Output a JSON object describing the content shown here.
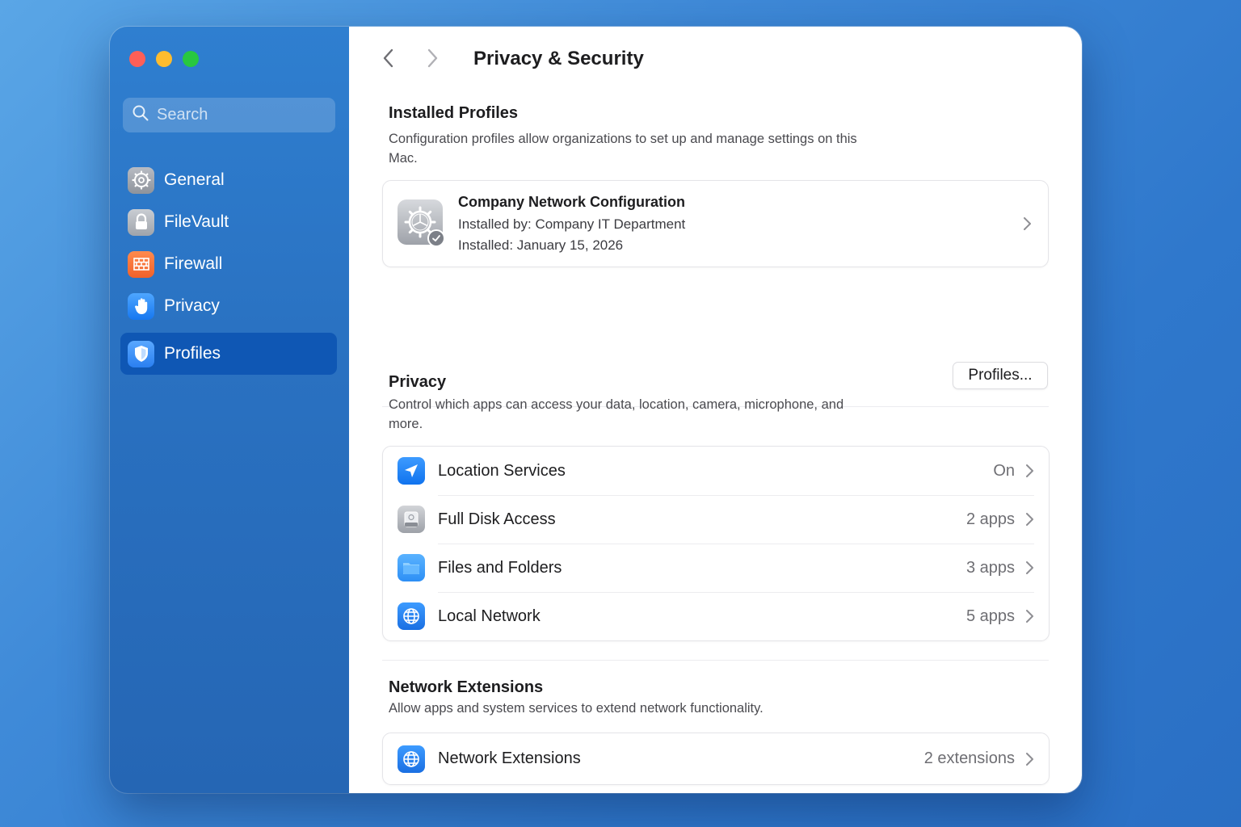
{
  "window": {
    "title": "Privacy & Security"
  },
  "sidebar": {
    "search_placeholder": "Search",
    "items": [
      {
        "label": "General",
        "icon": "gear-icon"
      },
      {
        "label": "FileVault",
        "icon": "lock-icon"
      },
      {
        "label": "Firewall",
        "icon": "firewall-icon"
      },
      {
        "label": "Privacy",
        "icon": "hand-icon"
      },
      {
        "label": "Profiles",
        "icon": "shield-icon",
        "selected": true
      }
    ]
  },
  "main": {
    "installed_profiles": {
      "title": "Installed Profiles",
      "description": "Configuration profiles allow organizations to set up and manage settings on this Mac.",
      "profile": {
        "name": "Company Network Configuration",
        "installed_by": "Installed by: Company IT Department",
        "installed_date": "Installed: January 15, 2026"
      },
      "profiles_button": "Profiles..."
    },
    "privacy": {
      "title": "Privacy",
      "description": "Control which apps can access your data, location, camera, microphone, and more.",
      "rows": [
        {
          "label": "Location Services",
          "value": "On",
          "icon": "location-arrow-icon"
        },
        {
          "label": "Full Disk Access",
          "value": "2 apps",
          "icon": "disk-icon"
        },
        {
          "label": "Files and Folders",
          "value": "3 apps",
          "icon": "folder-icon"
        },
        {
          "label": "Local Network",
          "value": "5 apps",
          "icon": "globe-icon"
        }
      ]
    },
    "network_extensions": {
      "title": "Network Extensions",
      "description": "Allow apps and system services to extend network functionality.",
      "row": {
        "label": "Network Extensions",
        "value": "2 extensions",
        "icon": "globe-icon"
      }
    }
  },
  "colors": {
    "sidebar_bg": "#2a72c2",
    "sidebar_selected": "#0f57b4",
    "accent": "#1677f0",
    "close": "#fe5f57",
    "minimize": "#febc2e",
    "maximize": "#28c840"
  }
}
